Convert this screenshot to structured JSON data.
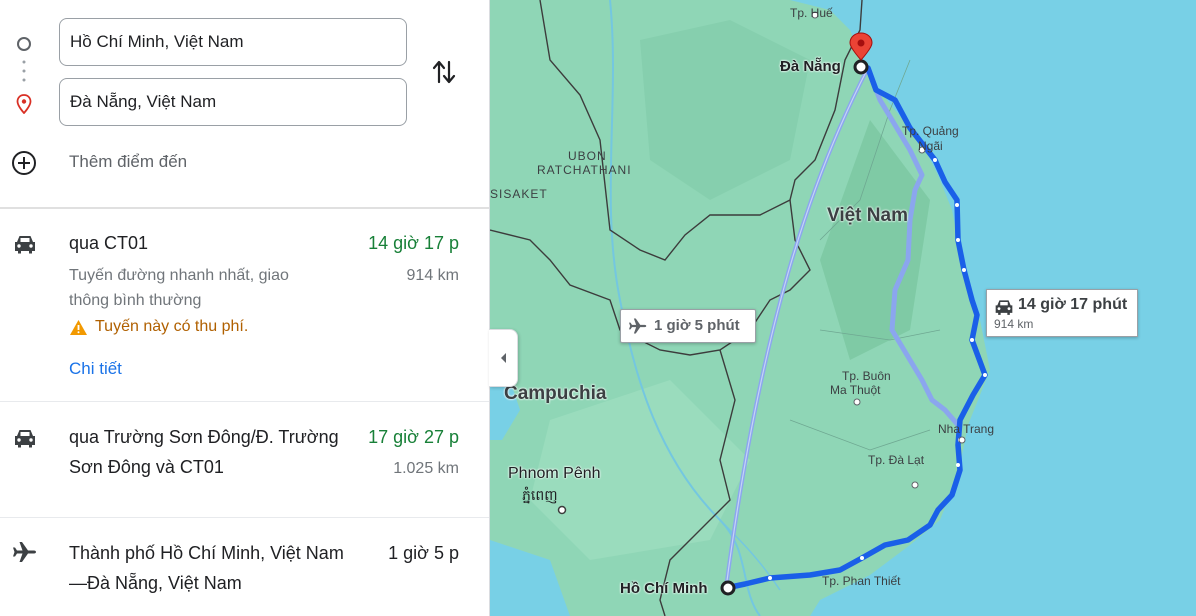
{
  "directions": {
    "origin_value": "Hồ Chí Minh, Việt Nam",
    "destination_value": "Đà Nẵng, Việt Nam",
    "add_destination_label": "Thêm điểm đến",
    "icons": {
      "origin": "circle-icon",
      "destination": "location-pin-icon",
      "swap": "swap-vertical-icon",
      "add": "add-circle-icon"
    }
  },
  "routes": [
    {
      "mode_icon": "car-icon",
      "title": "qua CT01",
      "time": "14 giờ 17 p",
      "distance": "914 km",
      "description": "Tuyến đường nhanh nhất, giao thông bình thường",
      "warning": "Tuyến này có thu phí.",
      "details_label": "Chi tiết"
    },
    {
      "mode_icon": "car-icon",
      "title": "qua Trường Sơn Đông/Đ. Trường Sơn Đông và CT01",
      "time": "17 giờ 27 p",
      "distance": "1.025 km"
    },
    {
      "mode_icon": "airplane-icon",
      "title": "Thành phố Hồ Chí Minh, Việt Nam—Đà Nẵng, Việt Nam",
      "time": "1 giờ 5 p"
    }
  ],
  "map": {
    "labels": {
      "hue": "Tp. Huế",
      "da_nang": "Đà Nẵng",
      "quang_ngai_1": "Tp. Quảng",
      "quang_ngai_2": "Ngãi",
      "ubon_1": "UBON",
      "ubon_2": "RATCHATHANI",
      "sisaket": "SISAKET",
      "viet_nam": "Việt Nam",
      "campuchia": "Campuchia",
      "buon_1": "Tp. Buôn",
      "buon_2": "Ma Thuột",
      "nha_trang": "Nha Trang",
      "da_lat": "Tp. Đà Lạt",
      "phnom_penh": "Phnom Pênh",
      "phnom_penh_khmer": "ភ្នំពេញ",
      "phan_thiet": "Tp. Phan Thiết",
      "ho_chi_minh": "Hồ Chí Minh"
    },
    "flight_callout": "1 giờ 5 phút",
    "drive_callout_time": "14 giờ 17 phút",
    "drive_callout_distance": "914 km",
    "colors": {
      "land": "#8fd6b6",
      "water": "#78d0e6",
      "route_primary": "#1a5fe8",
      "route_alt": "#8ba6ee",
      "border": "#3c3c3c"
    }
  }
}
